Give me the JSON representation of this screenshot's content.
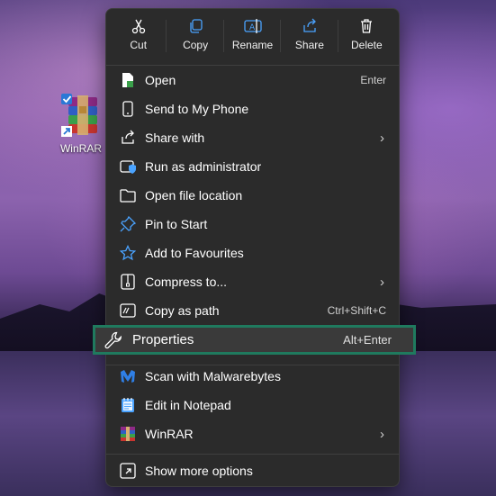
{
  "desktop": {
    "icon_label": "WinRAR"
  },
  "toolbar": {
    "cut": "Cut",
    "copy": "Copy",
    "rename": "Rename",
    "share": "Share",
    "delete": "Delete"
  },
  "items": {
    "open": {
      "label": "Open",
      "shortcut": "Enter"
    },
    "send_phone": {
      "label": "Send to My Phone"
    },
    "share_with": {
      "label": "Share with"
    },
    "run_admin": {
      "label": "Run as administrator"
    },
    "open_location": {
      "label": "Open file location"
    },
    "pin_start": {
      "label": "Pin to Start"
    },
    "favourites": {
      "label": "Add to Favourites"
    },
    "compress": {
      "label": "Compress to..."
    },
    "copy_path": {
      "label": "Copy as path",
      "shortcut": "Ctrl+Shift+C"
    },
    "properties": {
      "label": "Properties",
      "shortcut": "Alt+Enter"
    },
    "malwarebytes": {
      "label": "Scan with Malwarebytes"
    },
    "notepad": {
      "label": "Edit in Notepad"
    },
    "winrar": {
      "label": "WinRAR"
    },
    "more_options": {
      "label": "Show more options"
    }
  },
  "colors": {
    "menu_bg": "#2b2b2b",
    "highlight_border": "#1f7a5e",
    "accent_blue": "#4aa3ff"
  }
}
